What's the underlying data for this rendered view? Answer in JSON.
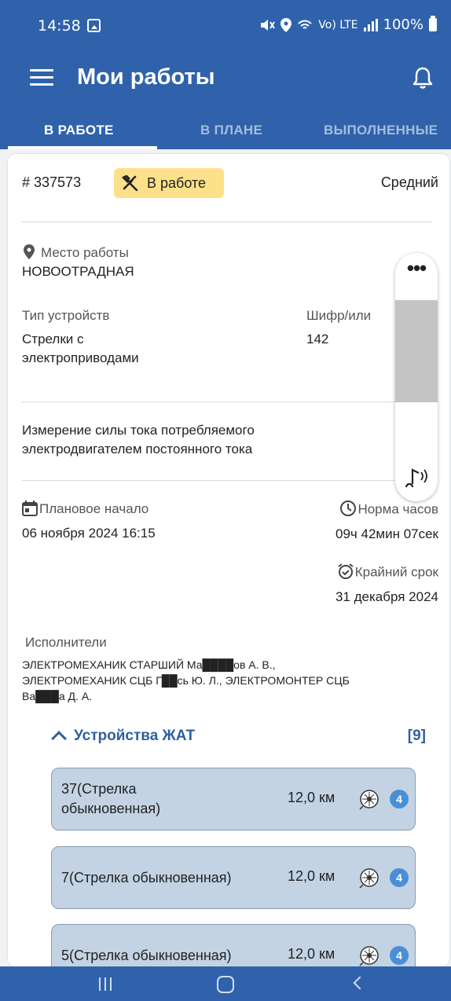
{
  "status_bar": {
    "time": "14:58",
    "network": "Vo) LTE",
    "battery": "100%"
  },
  "appbar": {
    "title": "Мои работы"
  },
  "tabs": [
    {
      "label": "В РАБОТЕ",
      "active": true
    },
    {
      "label": "В ПЛАНЕ",
      "active": false
    },
    {
      "label": "ВЫПОЛНЕННЫЕ",
      "active": false
    }
  ],
  "task": {
    "number": "# 337573",
    "status": "В работе",
    "priority": "Средний",
    "location_label": "Место работы",
    "location_value": "НОВООТРАДНАЯ",
    "device_type_label": "Тип устройств",
    "device_type_value_1": "Стрелки с",
    "device_type_value_2": "электроприводами",
    "code_label": "Шифр/или",
    "code_value": "142",
    "description_1": "Измерение силы тока потребляемого",
    "description_2": "электродвигателем постоянного тока",
    "plan_start_label": "Плановое начало",
    "plan_start_value": "06 ноября 2024  16:15",
    "norm_label": "Норма часов",
    "norm_value": "09ч 42мин 07сек",
    "deadline_label": "Крайний срок",
    "deadline_value": "31 декабря 2024",
    "executors_label": "Исполнители",
    "executors_line1": "ЭЛЕКТРОМЕХАНИК СТАРШИЙ Ма████ов А. В.,",
    "executors_line2": "ЭЛЕКТРОМЕХАНИК СЦБ Г██сь Ю. Л., ЭЛЕКТРОМОНТЕР СЦБ",
    "executors_line3": "Ва███а Д. А."
  },
  "devices_section": {
    "title": "Устройства ЖАТ",
    "count": "[9]",
    "items": [
      {
        "name_1": "37(Стрелка",
        "name_2": "обыкновенная)",
        "distance": "12,0 км",
        "badge": "4"
      },
      {
        "name_1": "7(Стрелка обыкновенная)",
        "name_2": "",
        "distance": "12,0 км",
        "badge": "4"
      },
      {
        "name_1": "5(Стрелка обыкновенная)",
        "name_2": "",
        "distance": "12,0 км",
        "badge": "4"
      }
    ]
  },
  "colors": {
    "primary": "#2f62ab",
    "status_badge": "#fde18a",
    "device_item_bg": "#c3d3e4",
    "count_badge": "#4a8fd6"
  }
}
